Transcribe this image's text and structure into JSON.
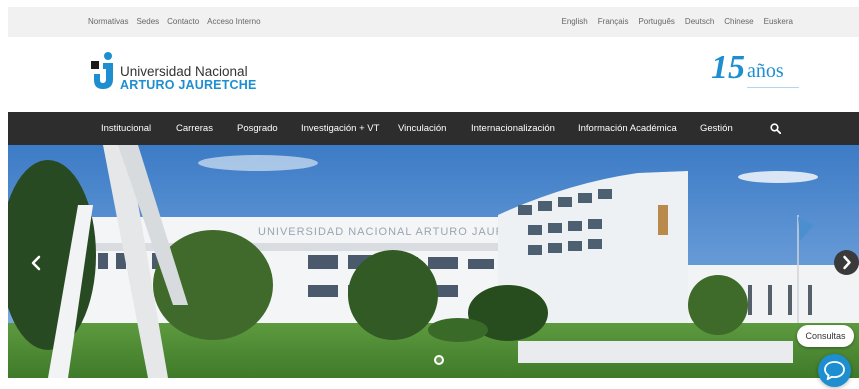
{
  "topbar": {
    "left_links": [
      "Normativas",
      "Sedes",
      "Contacto",
      "Acceso Interno"
    ],
    "languages": [
      "English",
      "Français",
      "Português",
      "Deutsch",
      "Chinese",
      "Euskera"
    ]
  },
  "header": {
    "logo_line1": "Universidad Nacional",
    "logo_line2": "ARTURO JAURETCHE",
    "anniversary_number": "15",
    "anniversary_word": "años"
  },
  "nav": {
    "items": [
      "Institucional",
      "Carreras",
      "Posgrado",
      "Investigación + VT",
      "Vinculación",
      "Internacionalización",
      "Información Académica",
      "Gestión"
    ],
    "search_icon": "search-icon"
  },
  "hero": {
    "building_inscription": "UNIVERSIDAD NACIONAL ARTURO JAURETCHE",
    "slide_count": 1,
    "active_slide": 1,
    "prev_icon": "chevron-left-icon",
    "next_icon": "chevron-right-icon"
  },
  "consultas": {
    "label": "Consultas",
    "chat_icon": "chat-bubble-icon"
  },
  "colors": {
    "brand_blue": "#1d8fd0",
    "nav_background": "#2d2d2d",
    "topbar_background": "#f1f1f1"
  }
}
